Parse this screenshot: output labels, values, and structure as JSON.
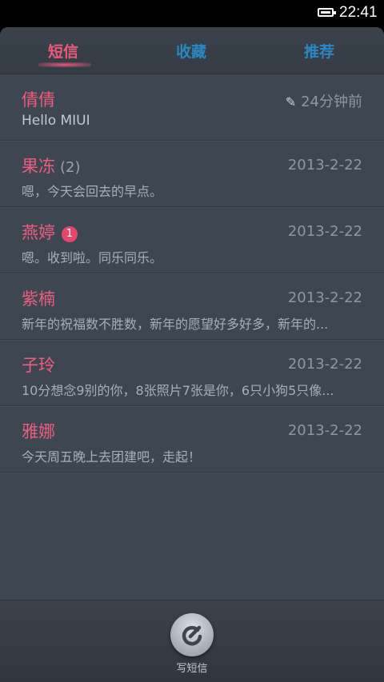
{
  "status_bar": {
    "time": "22:41"
  },
  "tabs": [
    {
      "label": "短信",
      "active": true
    },
    {
      "label": "收藏",
      "active": false
    },
    {
      "label": "推荐",
      "active": false
    }
  ],
  "conversations": [
    {
      "name": "倩倩",
      "count": "",
      "unread": "",
      "time": "24分钟前",
      "draft": true,
      "preview": "Hello MIUI"
    },
    {
      "name": "果冻",
      "count": "(2)",
      "unread": "",
      "time": "2013-2-22",
      "draft": false,
      "preview": "嗯，今天会回去的早点。"
    },
    {
      "name": "燕婷",
      "count": "",
      "unread": "1",
      "time": "2013-2-22",
      "draft": false,
      "preview": "嗯。收到啦。同乐同乐。"
    },
    {
      "name": "紫楠",
      "count": "",
      "unread": "",
      "time": "2013-2-22",
      "draft": false,
      "preview": "新年的祝福数不胜数，新年的愿望好多好多，新年的..."
    },
    {
      "name": "子玲",
      "count": "",
      "unread": "",
      "time": "2013-2-22",
      "draft": false,
      "preview": "10分想念9别的你，8张照片7张是你，6只小狗5只像..."
    },
    {
      "name": "雅娜",
      "count": "",
      "unread": "",
      "time": "2013-2-22",
      "draft": false,
      "preview": "今天周五晚上去团建吧，走起！"
    }
  ],
  "compose": {
    "label": "写短信"
  },
  "colors": {
    "accent": "#ec5d80",
    "tab_inactive": "#2b86c3",
    "background": "#3e4651"
  }
}
